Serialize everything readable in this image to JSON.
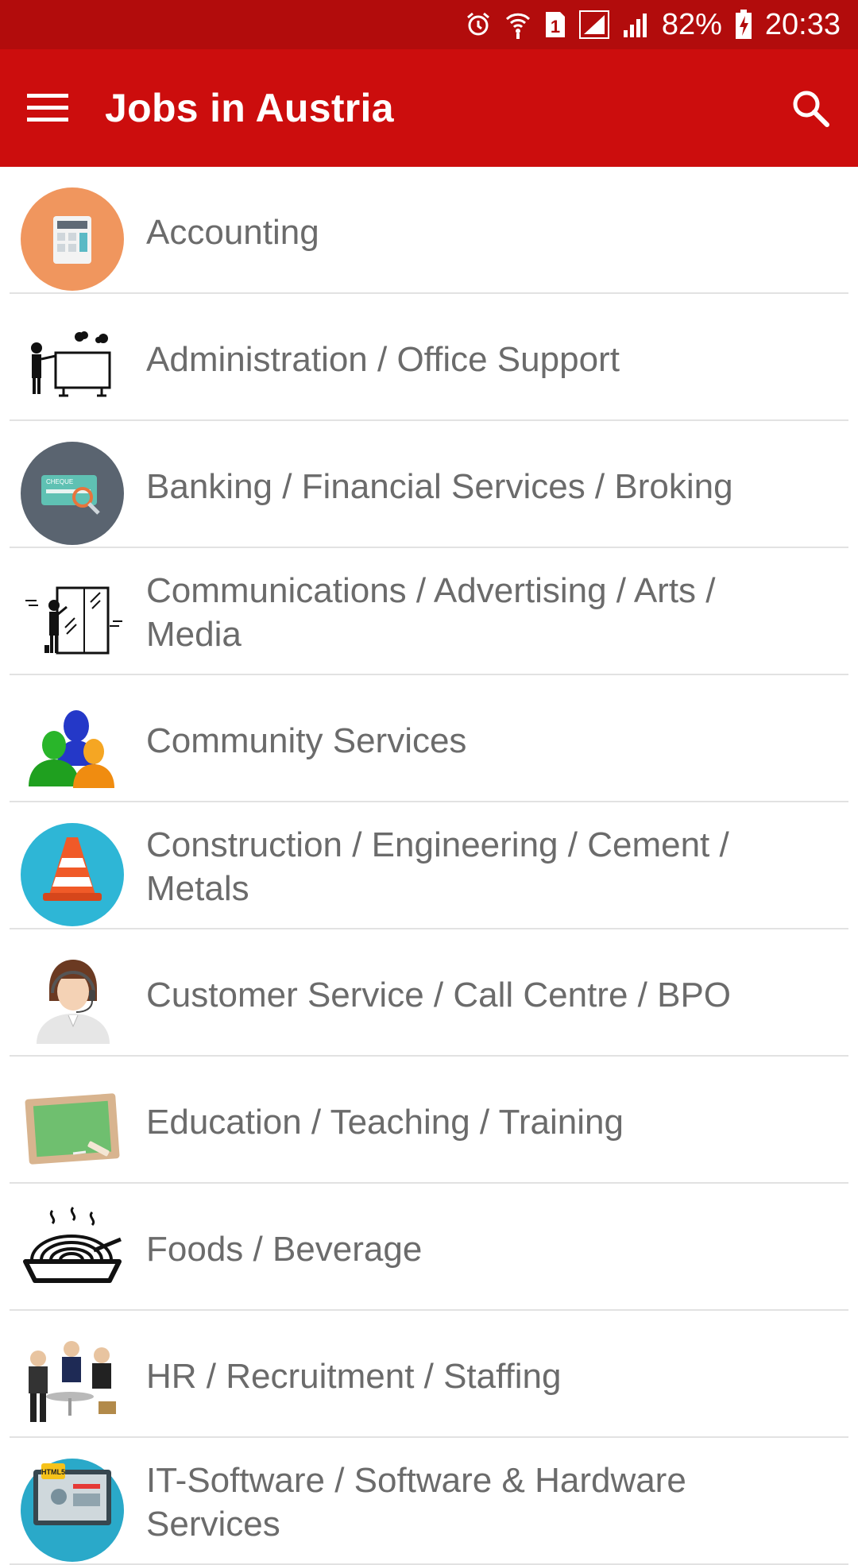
{
  "status_bar": {
    "battery": "82%",
    "time": "20:33",
    "sim_badge": "1"
  },
  "app_bar": {
    "title": "Jobs in Austria",
    "menu_icon": "hamburger-menu-icon",
    "search_icon": "search-icon"
  },
  "categories": [
    {
      "label": "Accounting",
      "icon": "calculator-icon"
    },
    {
      "label": "Administration / Office Support",
      "icon": "presenter-board-icon"
    },
    {
      "label": "Banking / Financial Services / Broking",
      "icon": "cheque-icon"
    },
    {
      "label": "Communications / Advertising / Arts / Media",
      "icon": "artist-window-icon"
    },
    {
      "label": "Community Services",
      "icon": "people-group-icon"
    },
    {
      "label": "Construction / Engineering / Cement / Metals",
      "icon": "traffic-cone-icon"
    },
    {
      "label": "Customer Service / Call Centre / BPO",
      "icon": "headset-agent-icon"
    },
    {
      "label": "Education / Teaching / Training",
      "icon": "chalkboard-icon"
    },
    {
      "label": "Foods / Beverage",
      "icon": "noodle-bowl-icon"
    },
    {
      "label": "HR / Recruitment / Staffing",
      "icon": "business-people-icon"
    },
    {
      "label": "IT-Software / Software & Hardware Services",
      "icon": "computer-html5-icon"
    }
  ],
  "colors": {
    "status_bar": "#b20c0c",
    "app_bar": "#cc0d0d",
    "text": "#6b6b6b",
    "divider": "#e2e2e2"
  }
}
